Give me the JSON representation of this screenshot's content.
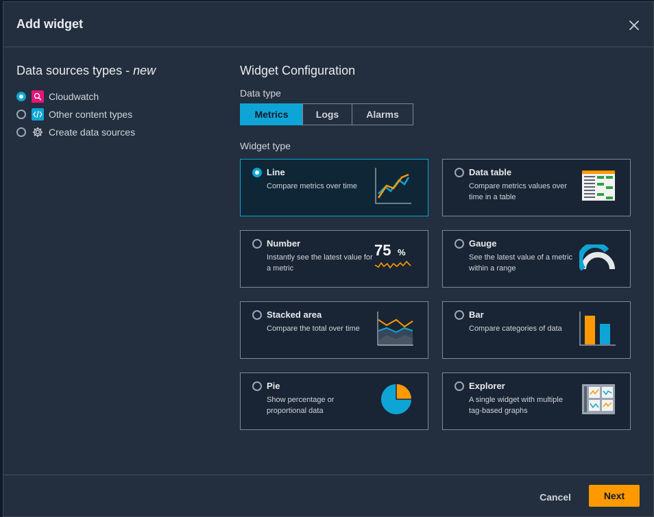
{
  "modal": {
    "title": "Add widget"
  },
  "data_sources": {
    "heading": "Data sources types - ",
    "heading_em": "new",
    "items": [
      {
        "label": "Cloudwatch",
        "icon": "cloudwatch-icon",
        "selected": true
      },
      {
        "label": "Other content types",
        "icon": "code-icon",
        "selected": false
      },
      {
        "label": "Create data sources",
        "icon": "gear-icon",
        "selected": false
      }
    ]
  },
  "config": {
    "heading": "Widget Configuration",
    "data_type_label": "Data type",
    "data_types": [
      "Metrics",
      "Logs",
      "Alarms"
    ],
    "data_type_selected": "Metrics",
    "widget_type_label": "Widget type",
    "widgets": [
      {
        "title": "Line",
        "desc": "Compare metrics over time",
        "icon": "line-chart-icon",
        "selected": true
      },
      {
        "title": "Data table",
        "desc": "Compare metrics values over time in a table",
        "icon": "table-icon",
        "selected": false
      },
      {
        "title": "Number",
        "desc": "Instantly see the latest value for a metric",
        "icon": "number-icon",
        "selected": false,
        "art_value": "75",
        "art_unit": "%"
      },
      {
        "title": "Gauge",
        "desc": "See the latest value of a metric within a range",
        "icon": "gauge-icon",
        "selected": false
      },
      {
        "title": "Stacked area",
        "desc": "Compare the total over time",
        "icon": "stacked-area-icon",
        "selected": false
      },
      {
        "title": "Bar",
        "desc": "Compare categories of data",
        "icon": "bar-chart-icon",
        "selected": false
      },
      {
        "title": "Pie",
        "desc": "Show percentage or proportional data",
        "icon": "pie-chart-icon",
        "selected": false
      },
      {
        "title": "Explorer",
        "desc": "A single widget with multiple tag-based graphs",
        "icon": "explorer-icon",
        "selected": false
      }
    ]
  },
  "footer": {
    "cancel_label": "Cancel",
    "next_label": "Next"
  },
  "colors": {
    "accent": "#0ea5d6",
    "primary_button": "#ff9900",
    "chart_orange": "#ff9900",
    "chart_blue": "#0ea5d6",
    "cloudwatch_pink": "#e7157b"
  }
}
